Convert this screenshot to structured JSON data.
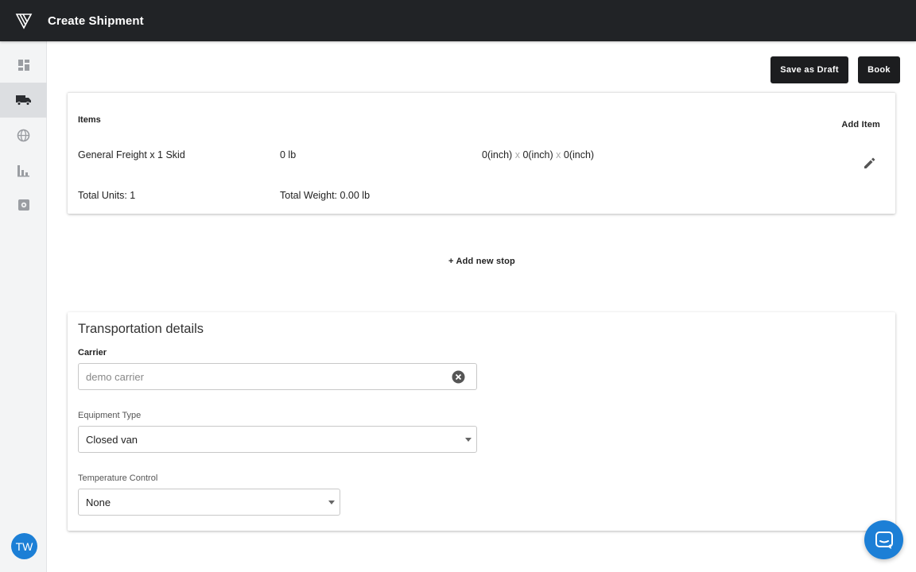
{
  "header": {
    "title": "Create Shipment",
    "logo_icon": "brand-logo-icon"
  },
  "sidebar": {
    "items": [
      {
        "name": "dashboard",
        "icon": "dashboard-icon",
        "active": false
      },
      {
        "name": "shipments",
        "icon": "truck-icon",
        "active": true
      },
      {
        "name": "network",
        "icon": "globe-icon",
        "active": false
      },
      {
        "name": "analytics",
        "icon": "bar-chart-icon",
        "active": false
      },
      {
        "name": "settings",
        "icon": "settings-icon",
        "active": false
      }
    ],
    "avatar_initials": "TW"
  },
  "toolbar": {
    "save_draft_label": "Save as Draft",
    "book_label": "Book"
  },
  "items_section": {
    "heading": "Items",
    "add_item_label": "Add Item",
    "rows": [
      {
        "description": "General Freight x 1 Skid",
        "weight": "0 lb",
        "dim_l": "0(inch)",
        "dim_w": "0(inch)",
        "dim_h": "0(inch)",
        "separator": "x"
      }
    ],
    "total_units": "Total Units: 1",
    "total_weight": "Total Weight: 0.00 lb"
  },
  "add_stop_label": "+ Add new stop",
  "transport": {
    "title": "Transportation details",
    "carrier_label": "Carrier",
    "carrier_placeholder": "demo carrier",
    "equipment_label": "Equipment Type",
    "equipment_value": "Closed van",
    "temperature_label": "Temperature Control",
    "temperature_value": "None"
  },
  "colors": {
    "accent": "#1c7fd6",
    "topbar": "#212326",
    "button": "#1c1d1f"
  }
}
